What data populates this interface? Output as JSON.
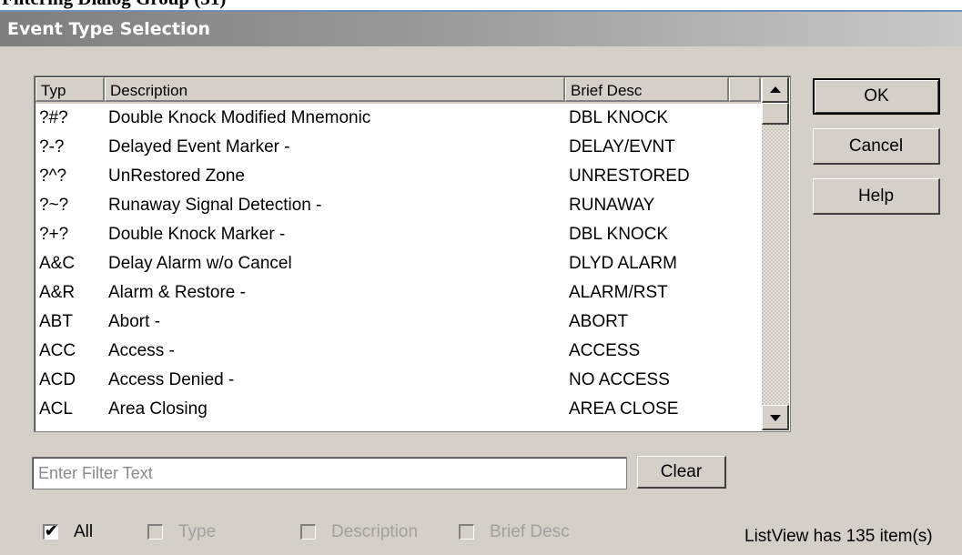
{
  "doc_title": "Filtering Dialog Group (31)",
  "dialog": {
    "title": "Event Type Selection",
    "columns": [
      "Typ",
      "Description",
      "Brief Desc"
    ],
    "rows": [
      {
        "typ": "?#?",
        "desc": "Double Knock Modified Mnemonic",
        "brief": "DBL KNOCK"
      },
      {
        "typ": "?-?",
        "desc": "Delayed Event Marker -",
        "brief": "DELAY/EVNT"
      },
      {
        "typ": "?^?",
        "desc": "UnRestored Zone",
        "brief": "UNRESTORED"
      },
      {
        "typ": "?~?",
        "desc": "Runaway Signal Detection -",
        "brief": "RUNAWAY"
      },
      {
        "typ": "?+?",
        "desc": "Double Knock Marker -",
        "brief": "DBL KNOCK"
      },
      {
        "typ": "A&C",
        "desc": "Delay Alarm w/o Cancel",
        "brief": "DLYD ALARM"
      },
      {
        "typ": "A&R",
        "desc": "Alarm & Restore -",
        "brief": "ALARM/RST"
      },
      {
        "typ": "ABT",
        "desc": "Abort -",
        "brief": "ABORT"
      },
      {
        "typ": "ACC",
        "desc": "Access -",
        "brief": "ACCESS"
      },
      {
        "typ": "ACD",
        "desc": "Access Denied -",
        "brief": "NO ACCESS"
      },
      {
        "typ": "ACL",
        "desc": "Area Closing",
        "brief": "AREA CLOSE"
      }
    ],
    "buttons": {
      "ok": "OK",
      "cancel": "Cancel",
      "help": "Help",
      "clear": "Clear"
    },
    "filter": {
      "placeholder": "Enter Filter Text",
      "value": ""
    },
    "checkboxes": {
      "all": {
        "label": "All",
        "checked": true,
        "enabled": true
      },
      "type": {
        "label": "Type",
        "checked": false,
        "enabled": false
      },
      "description": {
        "label": "Description",
        "checked": false,
        "enabled": false
      },
      "brief": {
        "label": "Brief Desc",
        "checked": false,
        "enabled": false
      }
    },
    "status": "ListView has 135 item(s)"
  }
}
